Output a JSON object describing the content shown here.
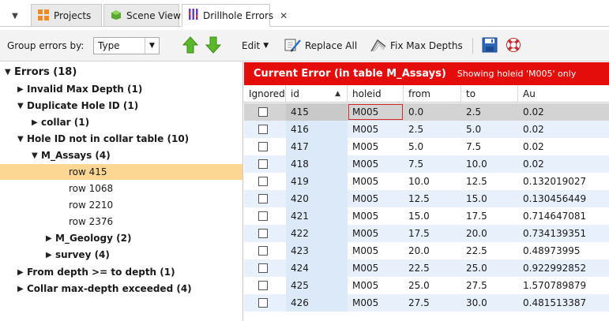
{
  "tabs": [
    {
      "label": "Projects",
      "icon": "projects-icon"
    },
    {
      "label": "Scene View",
      "icon": "scene-view-icon"
    },
    {
      "label": "Drillhole Errors",
      "icon": "drillhole-errors-icon",
      "close": "✕"
    }
  ],
  "toolbar": {
    "group_label": "Group errors by:",
    "group_value": "Type",
    "edit_label": "Edit",
    "replace_all_label": "Replace All",
    "fix_max_depths_label": "Fix Max Depths"
  },
  "tree": {
    "items": [
      {
        "label": "Errors (18)",
        "expanded": true,
        "bold": true
      },
      {
        "label": "Invalid Max Depth (1)",
        "expanded": false,
        "bold": true
      },
      {
        "label": "Duplicate Hole ID (1)",
        "expanded": true,
        "bold": true
      },
      {
        "label": "collar (1)",
        "expanded": false,
        "bold": true
      },
      {
        "label": "Hole ID not in collar table (10)",
        "expanded": true,
        "bold": true
      },
      {
        "label": "M_Assays (4)",
        "expanded": true,
        "bold": true
      },
      {
        "label": "row 415",
        "selected": true
      },
      {
        "label": "row 1068"
      },
      {
        "label": "row 2210"
      },
      {
        "label": "row 2376"
      },
      {
        "label": "M_Geology (2)",
        "expanded": false,
        "bold": true
      },
      {
        "label": "survey (4)",
        "expanded": false,
        "bold": true
      },
      {
        "label": "From depth >= to depth (1)",
        "expanded": false,
        "bold": true
      },
      {
        "label": "Collar max-depth exceeded (4)",
        "expanded": false,
        "bold": true
      }
    ]
  },
  "current_error": {
    "title": "Current Error (in table M_Assays)",
    "subtitle": "Showing holeid 'M005' only"
  },
  "grid": {
    "columns": [
      "Ignored",
      "id",
      "holeid",
      "from",
      "to",
      "Au"
    ],
    "rows": [
      {
        "id": "415",
        "holeid": "M005",
        "from": "0.0",
        "to": "2.5",
        "au": "0.02",
        "current": true
      },
      {
        "id": "416",
        "holeid": "M005",
        "from": "2.5",
        "to": "5.0",
        "au": "0.02"
      },
      {
        "id": "417",
        "holeid": "M005",
        "from": "5.0",
        "to": "7.5",
        "au": "0.02"
      },
      {
        "id": "418",
        "holeid": "M005",
        "from": "7.5",
        "to": "10.0",
        "au": "0.02"
      },
      {
        "id": "419",
        "holeid": "M005",
        "from": "10.0",
        "to": "12.5",
        "au": "0.132019027"
      },
      {
        "id": "420",
        "holeid": "M005",
        "from": "12.5",
        "to": "15.0",
        "au": "0.130456449"
      },
      {
        "id": "421",
        "holeid": "M005",
        "from": "15.0",
        "to": "17.5",
        "au": "0.714647081"
      },
      {
        "id": "422",
        "holeid": "M005",
        "from": "17.5",
        "to": "20.0",
        "au": "0.734139351"
      },
      {
        "id": "423",
        "holeid": "M005",
        "from": "20.0",
        "to": "22.5",
        "au": "0.48973995"
      },
      {
        "id": "424",
        "holeid": "M005",
        "from": "22.5",
        "to": "25.0",
        "au": "0.922992852"
      },
      {
        "id": "425",
        "holeid": "M005",
        "from": "25.0",
        "to": "27.5",
        "au": "1.570789879"
      },
      {
        "id": "426",
        "holeid": "M005",
        "from": "27.5",
        "to": "30.0",
        "au": "0.481513387"
      }
    ]
  }
}
